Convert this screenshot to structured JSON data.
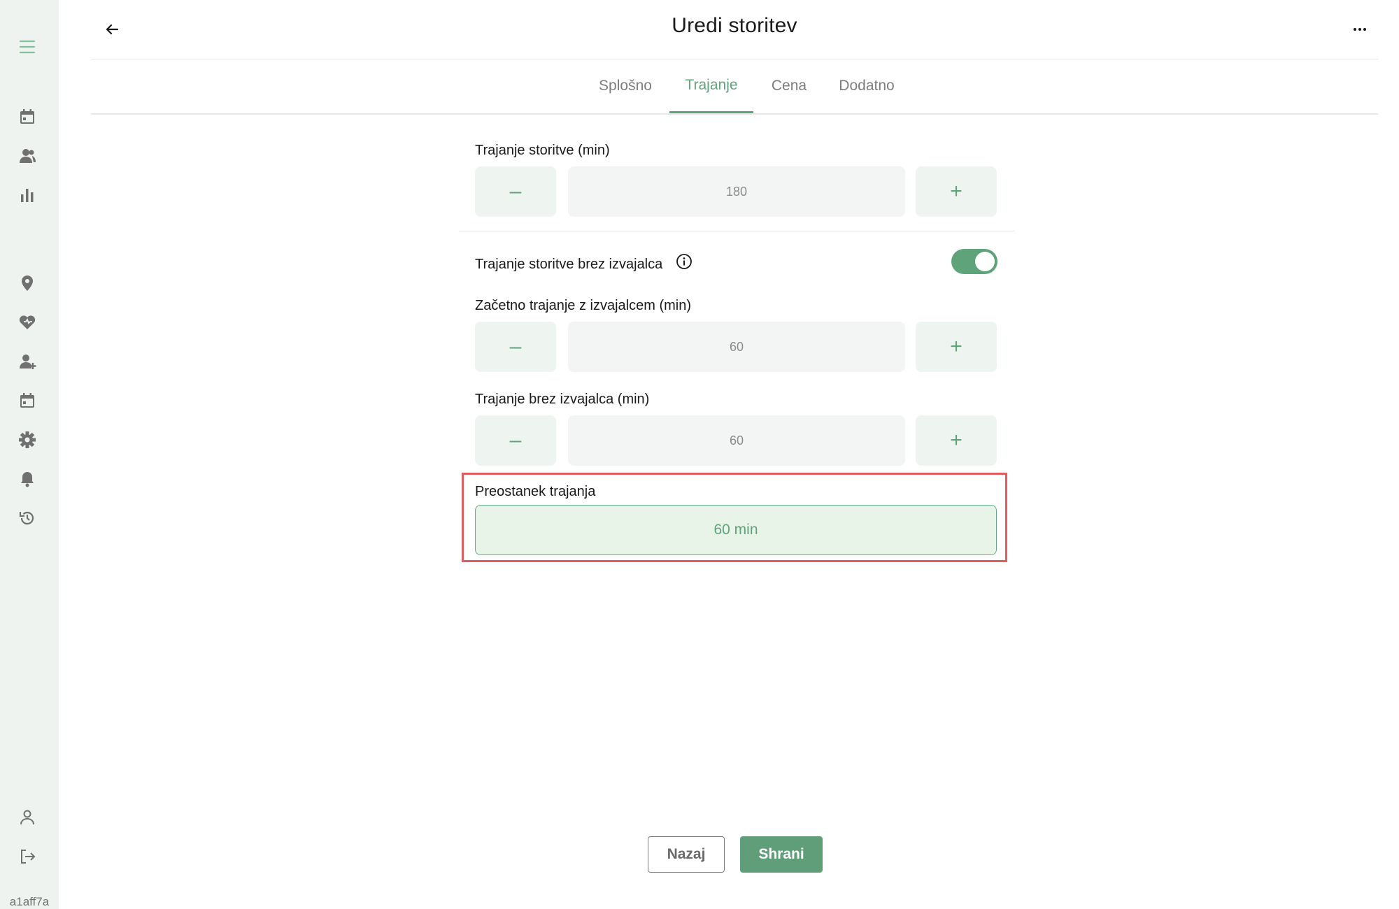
{
  "header": {
    "title": "Uredi storitev"
  },
  "tabs": [
    {
      "label": "Splošno"
    },
    {
      "label": "Trajanje"
    },
    {
      "label": "Cena"
    },
    {
      "label": "Dodatno"
    }
  ],
  "active_tab": "Trajanje",
  "form": {
    "service_duration": {
      "label": "Trajanje storitve (min)",
      "value": "180"
    },
    "duration_without_provider_toggle": {
      "label": "Trajanje storitve brez izvajalca",
      "enabled": true
    },
    "initial_duration": {
      "label": "Začetno trajanje z izvajalcem (min)",
      "value": "60"
    },
    "duration_without_provider": {
      "label": "Trajanje brez izvajalca (min)",
      "value": "60"
    },
    "remaining_duration": {
      "label": "Preostanek trajanja",
      "value": "60 min"
    },
    "minus_symbol": "–",
    "plus_symbol": "+"
  },
  "footer": {
    "back_label": "Nazaj",
    "save_label": "Shrani"
  },
  "sidebar": {
    "icons": [
      "menu-icon",
      "calendar-icon",
      "clients-icon",
      "chart-icon",
      "location-icon",
      "services-icon",
      "add-employee-icon",
      "schedule-icon",
      "settings-icon",
      "notifications-icon",
      "history-icon",
      "profile-icon",
      "logout-icon"
    ],
    "version": "a1aff7a"
  },
  "colors": {
    "accent": "#5fa37a",
    "highlight": "#e25e5e",
    "sidebar_bg": "#eef3f0"
  }
}
